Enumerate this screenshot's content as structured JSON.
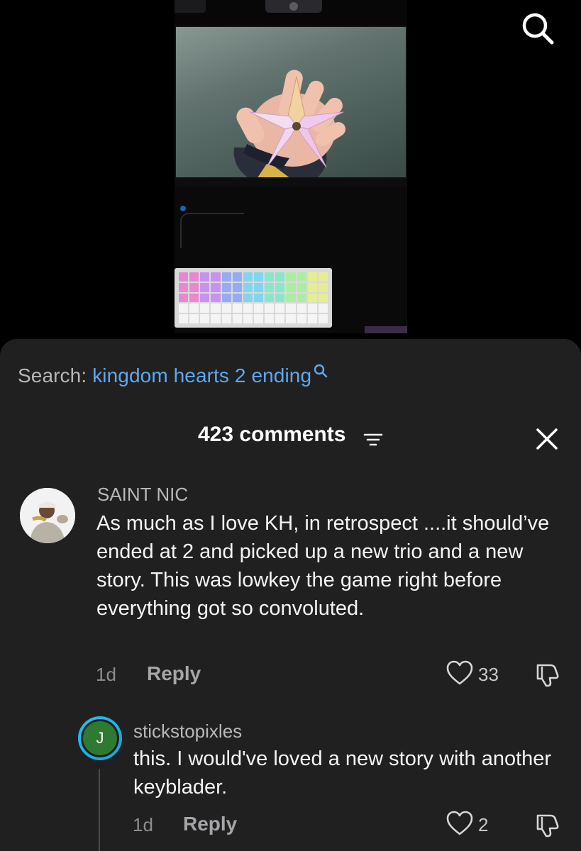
{
  "search": {
    "prefix": "Search:",
    "query": "kingdom hearts 2 ending"
  },
  "comments_header": {
    "count_label": "423 comments"
  },
  "comments": [
    {
      "username": "SAINT NIC",
      "text": "As much as I love KH, in retrospect ....it should’ve ended at 2 and picked up a new trio and a new story. This was lowkey the game right before everything got so convoluted.",
      "age": "1d",
      "reply_label": "Reply",
      "likes": "33"
    }
  ],
  "replies": [
    {
      "avatar_initial": "J",
      "username": "stickstopixles",
      "text": "this. I would've loved a new story with another keyblader.",
      "age": "1d",
      "reply_label": "Reply",
      "likes": "2"
    }
  ],
  "colors": {
    "sheet_background": "#202021",
    "link_blue": "#5fa8ef",
    "avatar_ring": "#22c3ec",
    "avatar_green": "#2e7a30"
  },
  "icons": [
    "search-icon",
    "sort-icon",
    "close-icon",
    "heart-icon",
    "dislike-icon"
  ]
}
